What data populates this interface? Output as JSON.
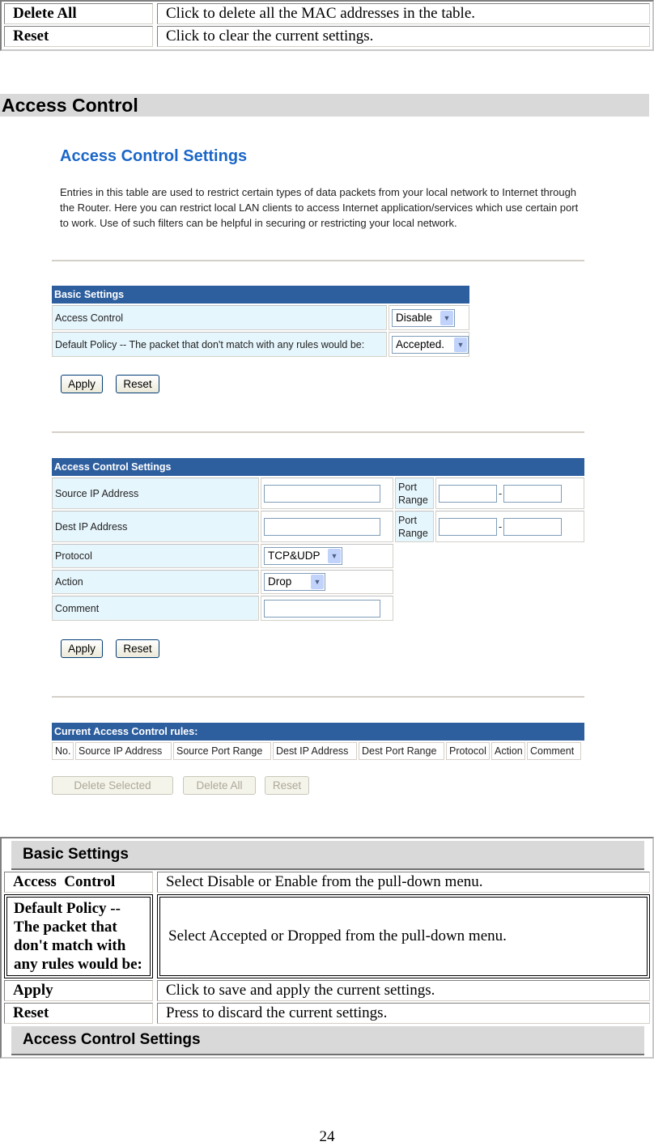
{
  "top_table": {
    "rows": [
      {
        "label": "Delete All",
        "desc": "Click to delete all the MAC addresses in the table."
      },
      {
        "label": "Reset",
        "desc": "Click to clear the current settings."
      }
    ]
  },
  "section_heading": "Access Control",
  "ui": {
    "title": "Access Control Settings",
    "intro": "Entries in this table are used to restrict certain types of data packets from your local network to Internet through the Router. Here you can restrict local LAN clients to access Internet application/services which use certain port to work. Use of such filters can be helpful in securing or restricting your local network.",
    "basic": {
      "header": "Basic Settings",
      "access_control_label": "Access Control",
      "access_control_value": "Disable",
      "default_policy_label": "Default Policy -- The packet that don't match with any rules would be:",
      "default_policy_value": "Accepted.",
      "apply": "Apply",
      "reset": "Reset"
    },
    "acs": {
      "header": "Access Control Settings",
      "source_ip_label": "Source IP Address",
      "source_ip_value": "",
      "dest_ip_label": "Dest IP Address",
      "dest_ip_value": "",
      "port_range_label_1": "Port",
      "port_range_label_2": "Range",
      "port_sep": "-",
      "src_port_from": "",
      "src_port_to": "",
      "dst_port_from": "",
      "dst_port_to": "",
      "protocol_label": "Protocol",
      "protocol_value": "TCP&UDP",
      "action_label": "Action",
      "action_value": "Drop",
      "comment_label": "Comment",
      "comment_value": "",
      "apply": "Apply",
      "reset": "Reset"
    },
    "rules": {
      "header": "Current Access Control rules:",
      "columns": [
        "No.",
        "Source IP Address",
        "Source Port Range",
        "Dest IP Address",
        "Dest Port Range",
        "Protocol",
        "Action",
        "Comment"
      ],
      "delete_selected": "Delete Selected",
      "delete_all": "Delete All",
      "reset": "Reset"
    }
  },
  "bottom_table": {
    "basic_header": "Basic Settings",
    "rows": [
      {
        "label": "Access  Control",
        "desc": "Select Disable or Enable from the pull-down menu."
      },
      {
        "label": "Default Policy -- The packet that don't match with any rules would be:",
        "desc": "Select Accepted or Dropped from the pull-down menu."
      },
      {
        "label": "Apply",
        "desc": "Click to save and apply the current settings."
      },
      {
        "label": "Reset",
        "desc": "Press to discard the current settings."
      }
    ],
    "acs_header": "Access Control Settings"
  },
  "page_number": "24",
  "icons": {
    "select_arrow": "chevron-down-icon"
  }
}
